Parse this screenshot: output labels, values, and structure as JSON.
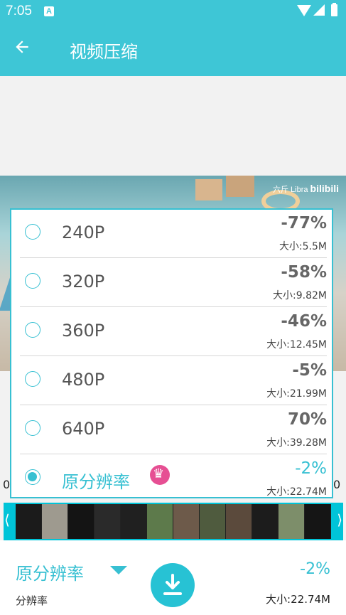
{
  "status_bar": {
    "time": "7:05",
    "notification_badge": "A"
  },
  "app_bar": {
    "title": "视频压缩",
    "back_icon": "arrow-left-icon"
  },
  "video": {
    "watermark_text": "六斤 Libra",
    "watermark_logo": "bilibili"
  },
  "colors": {
    "accent": "#37c0d2",
    "crown": "#e64f93"
  },
  "resolution_options": [
    {
      "label": "240P",
      "percent": "-77%",
      "size": "大小:5.5M",
      "selected": false
    },
    {
      "label": "320P",
      "percent": "-58%",
      "size": "大小:9.82M",
      "selected": false
    },
    {
      "label": "360P",
      "percent": "-46%",
      "size": "大小:12.45M",
      "selected": false
    },
    {
      "label": "480P",
      "percent": "-5%",
      "size": "大小:21.99M",
      "selected": false
    },
    {
      "label": "640P",
      "percent": "70%",
      "size": "大小:39.28M",
      "selected": false
    },
    {
      "label": "原分辨率",
      "percent": "-2%",
      "size": "大小:22.74M",
      "selected": true,
      "badge_icon": "crown-icon"
    }
  ],
  "film_strip": {
    "left_arrow": "⟨",
    "right_arrow": "⟩"
  },
  "bottom_panel": {
    "selected_resolution": "原分辨率",
    "caption": "分辨率",
    "percent": "-2%",
    "size": "大小:22.74M",
    "download_icon": "download-icon"
  }
}
